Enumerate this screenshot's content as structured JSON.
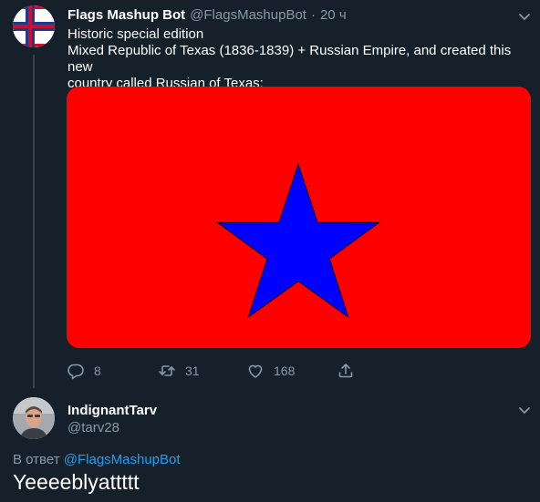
{
  "tweet": {
    "display_name": "Flags Mashup Bot",
    "handle": "@FlagsMashupBot",
    "separator": "·",
    "time": "20 ч",
    "text_lines": [
      "Historic special edition",
      "Mixed Republic of Texas (1836-1839) + Russian Empire, and created this new",
      "country called Russian of Texas:"
    ],
    "avatar_icon": "flag-avatar",
    "media_icon": "flag-image-blue-star-on-red",
    "media_colors": {
      "field": "#ff0000",
      "star": "#0000ff"
    },
    "actions": {
      "reply": {
        "icon": "reply-icon",
        "count": "8"
      },
      "retweet": {
        "icon": "retweet-icon",
        "count": "31"
      },
      "like": {
        "icon": "heart-icon",
        "count": "168"
      },
      "share": {
        "icon": "share-icon"
      }
    }
  },
  "reply": {
    "display_name": "IndignantTarv",
    "handle": "@tarv28",
    "reply_prefix": "В ответ",
    "reply_mention": "@FlagsMashupBot",
    "text": "Yeeeeblyattttt",
    "avatar_icon": "user-avatar"
  },
  "colors": {
    "background": "#15202b",
    "secondary_text": "#8899a6",
    "link": "#1da1f2",
    "divider": "#38444d"
  }
}
